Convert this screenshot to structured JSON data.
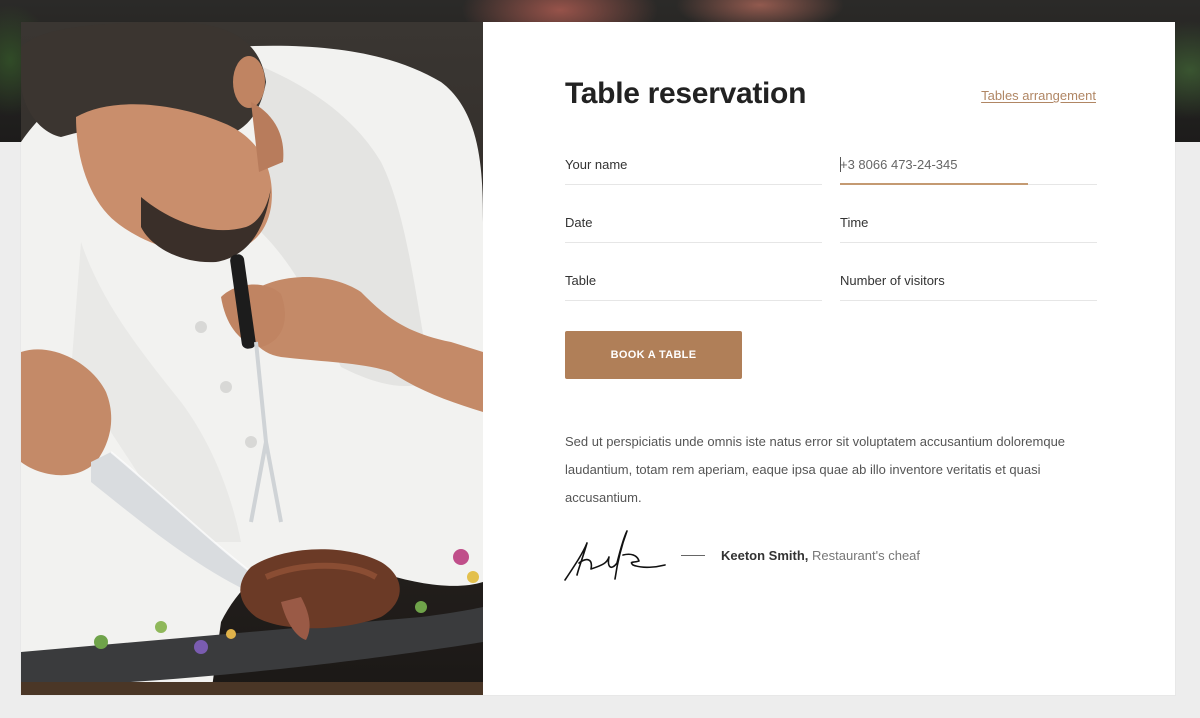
{
  "form": {
    "title": "Table reservation",
    "tables_link": "Tables arrangement",
    "fields": {
      "name_label": "Your name",
      "phone_value": "+3 8066 473-24-345",
      "date_label": "Date",
      "time_label": "Time",
      "table_label": "Table",
      "visitors_label": "Number of visitors"
    },
    "submit_label": "BOOK A TABLE"
  },
  "about": {
    "description": "Sed ut perspiciatis unde omnis iste natus error sit voluptatem accusantium doloremque laudantium, totam rem aperiam, eaque ipsa quae ab illo inventore veritatis et quasi accusantium.",
    "author_name": "Keeton Smith,",
    "author_role": "Restaurant's cheaf"
  },
  "colors": {
    "accent": "#b07f58",
    "link": "#b08664",
    "active_underline": "#c49a72"
  },
  "icons": {
    "signature": "handwritten-signature"
  }
}
